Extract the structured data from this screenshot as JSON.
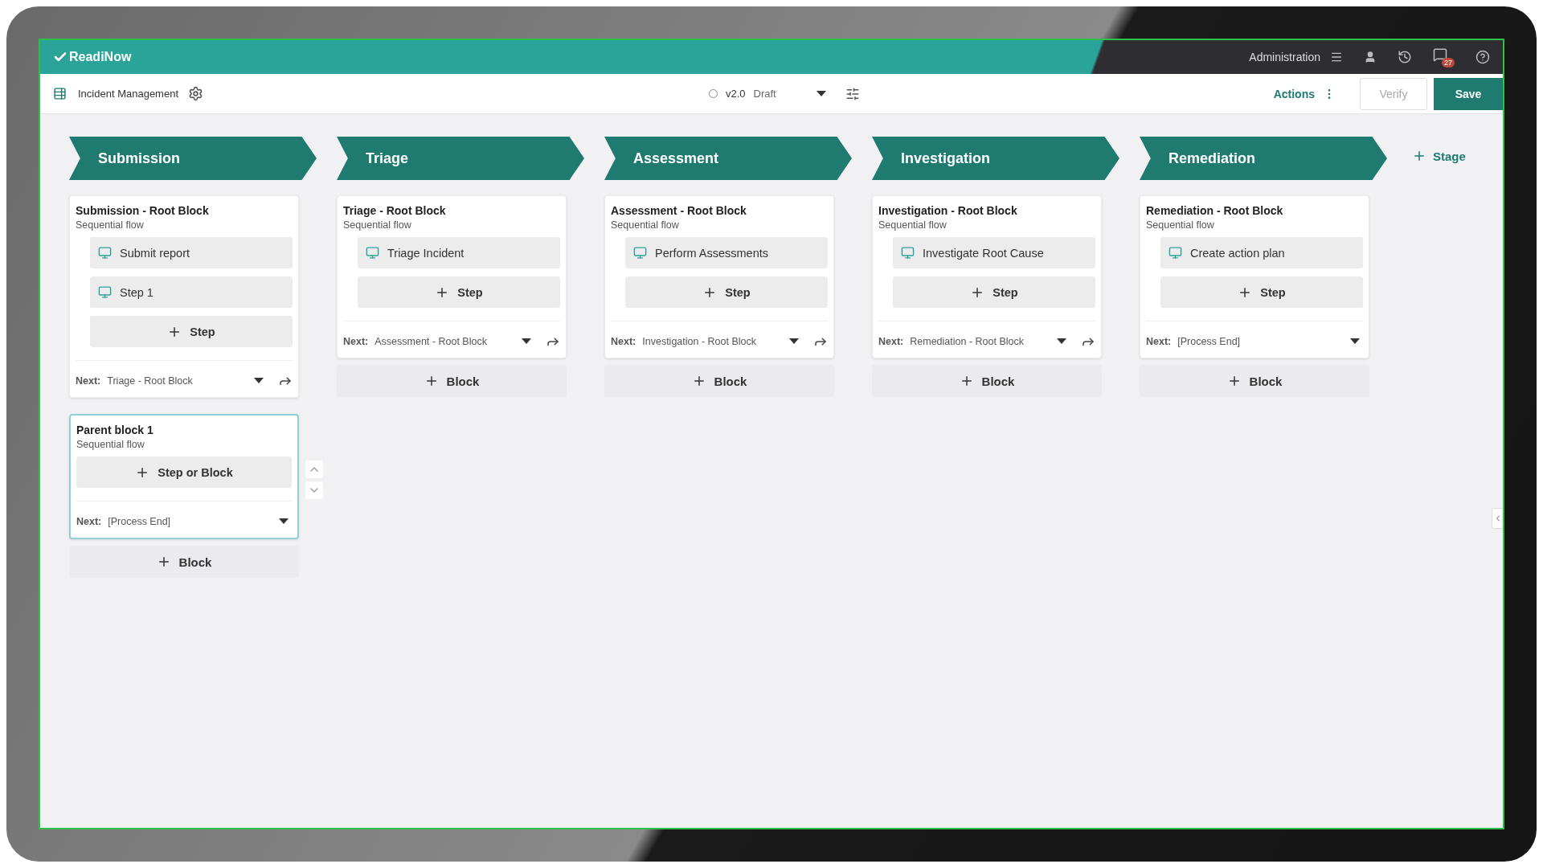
{
  "header": {
    "logo": "ReadiNow",
    "admin": "Administration",
    "notification_count": "27"
  },
  "toolbar": {
    "title": "Incident Management",
    "version": "v2.0",
    "status": "Draft",
    "actions": "Actions",
    "verify": {
      "label": "Verify",
      "disabled": true
    },
    "save": "Save"
  },
  "stages": [
    {
      "name": "Submission",
      "add_block": "Block",
      "blocks": [
        {
          "title": "Submission - Root Block",
          "subtitle": "Sequential flow",
          "steps": [
            "Submit report",
            "Step 1"
          ],
          "add_label": "Step",
          "next_label": "Next:",
          "next_value": "Triage - Root Block",
          "jump": true,
          "selected": false
        },
        {
          "title": "Parent block 1",
          "subtitle": "Sequential flow",
          "add_label": "Step or Block",
          "next_label": "Next:",
          "next_value": "[Process End]",
          "jump": false,
          "selected": true
        }
      ]
    },
    {
      "name": "Triage",
      "add_block": "Block",
      "blocks": [
        {
          "title": "Triage - Root Block",
          "subtitle": "Sequential flow",
          "steps": [
            "Triage Incident"
          ],
          "add_label": "Step",
          "next_label": "Next:",
          "next_value": "Assessment - Root Block",
          "jump": true,
          "selected": false
        }
      ]
    },
    {
      "name": "Assessment",
      "add_block": "Block",
      "blocks": [
        {
          "title": "Assessment - Root Block",
          "subtitle": "Sequential flow",
          "steps": [
            "Perform Assessments"
          ],
          "add_label": "Step",
          "next_label": "Next:",
          "next_value": "Investigation - Root Block",
          "jump": true,
          "selected": false
        }
      ]
    },
    {
      "name": "Investigation",
      "add_block": "Block",
      "blocks": [
        {
          "title": "Investigation - Root Block",
          "subtitle": "Sequential flow",
          "steps": [
            "Investigate Root Cause"
          ],
          "add_label": "Step",
          "next_label": "Next:",
          "next_value": "Remediation - Root Block",
          "jump": true,
          "selected": false
        }
      ]
    },
    {
      "name": "Remediation",
      "add_block": "Block",
      "blocks": [
        {
          "title": "Remediation - Root Block",
          "subtitle": "Sequential flow",
          "steps": [
            "Create action plan"
          ],
          "add_label": "Step",
          "next_label": "Next:",
          "next_value": "[Process End]",
          "jump": false,
          "selected": false
        }
      ]
    }
  ],
  "add_stage": "Stage"
}
